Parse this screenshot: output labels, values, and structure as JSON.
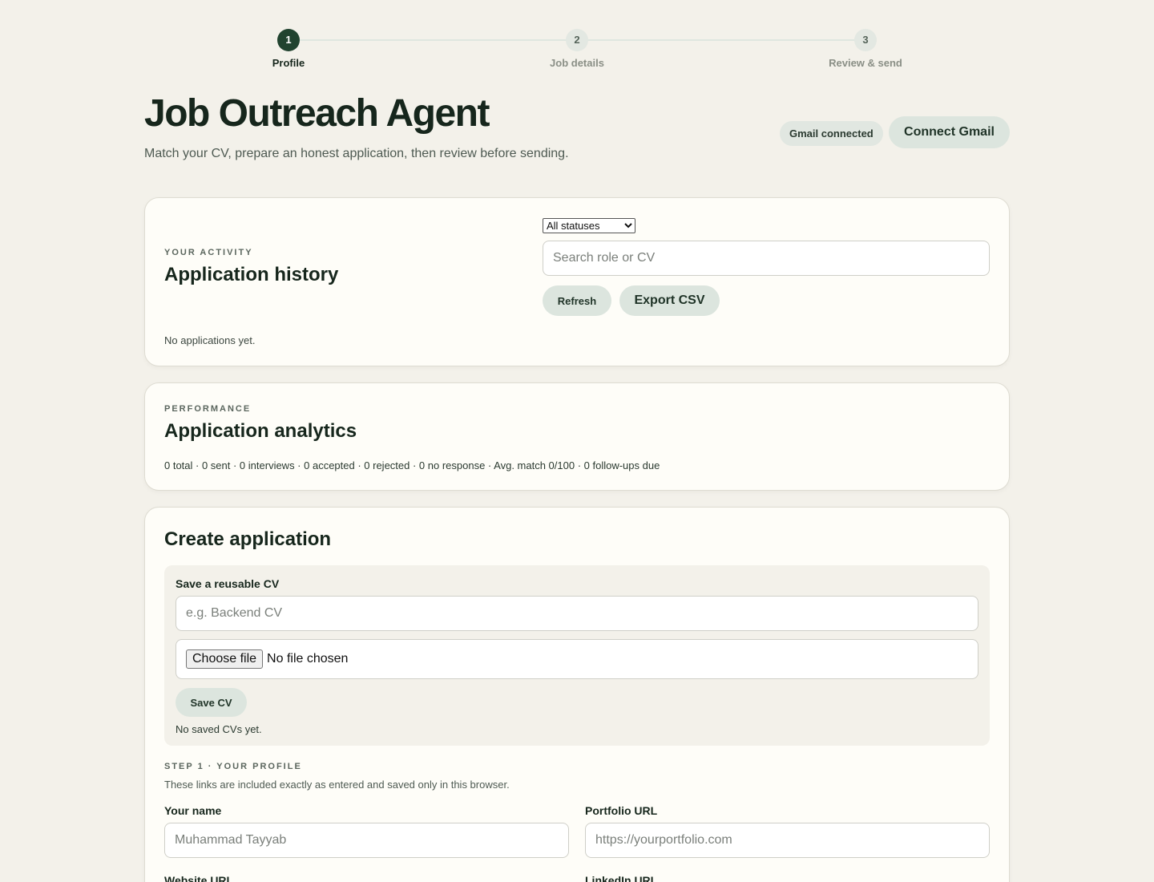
{
  "stepper": {
    "steps": [
      {
        "number": "1",
        "label": "Profile",
        "active": true
      },
      {
        "number": "2",
        "label": "Job details",
        "active": false
      },
      {
        "number": "3",
        "label": "Review & send",
        "active": false
      }
    ]
  },
  "header": {
    "title": "Job Outreach Agent",
    "subtitle": "Match your CV, prepare an honest application, then review before sending.",
    "gmail_status": "Gmail connected",
    "connect_label": "Connect Gmail"
  },
  "history": {
    "eyebrow": "YOUR ACTIVITY",
    "title": "Application history",
    "status_filter": "All statuses",
    "search_placeholder": "Search role or CV",
    "refresh_label": "Refresh",
    "export_label": "Export CSV",
    "empty_text": "No applications yet."
  },
  "analytics": {
    "eyebrow": "PERFORMANCE",
    "title": "Application analytics",
    "summary": "0 total · 0 sent · 0 interviews · 0 accepted · 0 rejected · 0 no response · Avg. match 0/100 · 0 follow-ups due"
  },
  "create": {
    "title": "Create application",
    "cv": {
      "label": "Save a reusable CV",
      "name_placeholder": "e.g. Backend CV",
      "file_button": "Choose file",
      "file_status": "No file chosen",
      "save_label": "Save CV",
      "empty_text": "No saved CVs yet."
    },
    "profile": {
      "eyebrow": "STEP 1 · YOUR PROFILE",
      "description": "These links are included exactly as entered and saved only in this browser.",
      "name_label": "Your name",
      "name_placeholder": "Muhammad Tayyab",
      "portfolio_label": "Portfolio URL",
      "portfolio_placeholder": "https://yourportfolio.com",
      "website_label": "Website URL",
      "linkedin_label": "LinkedIn URL"
    }
  },
  "colors": {
    "background": "#f3f1ea",
    "card": "#fefdf8",
    "accent": "#21432f",
    "button": "#dce5de"
  }
}
